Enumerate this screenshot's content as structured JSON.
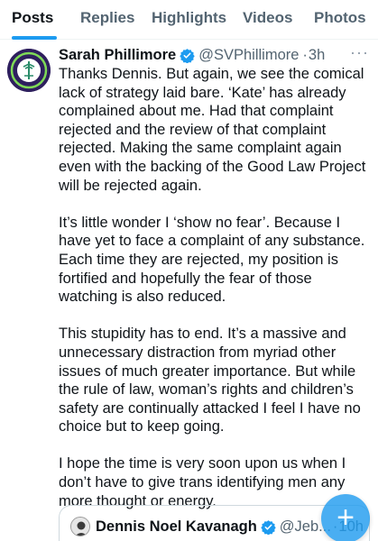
{
  "tabs": [
    {
      "label": "Posts",
      "active": true
    },
    {
      "label": "Replies",
      "active": false
    },
    {
      "label": "Highlights",
      "active": false
    },
    {
      "label": "Videos",
      "active": false
    },
    {
      "label": "Photos",
      "active": false
    }
  ],
  "post": {
    "author_name": "Sarah Phillimore",
    "handle": "@SVPhillimore",
    "separator": "·",
    "time": "3h",
    "more_label": "···",
    "paragraphs": [
      "Thanks Dennis. But again, we see the comical\nlack of strategy laid bare. ‘Kate’ has already\ncomplained about me. Had that complaint\nrejected and the review of that complaint\nrejected. Making the same complaint again\neven with the backing of the Good Law Project\nwill be rejected again.",
      "It’s little wonder I ‘show no fear’. Because I\nhave yet to face a complaint of any substance.\nEach time they are rejected, my position is\nfortified and hopefully the fear of those\nwatching is also reduced.",
      "This stupidity has to end. It’s a massive and\nunnecessary distraction from myriad other\nissues of much greater importance. But while\nthe rule of law, woman’s rights and children’s\nsafety are continually attacked I feel I have no\nchoice but to keep going.",
      "I hope the time is very soon upon us when I\ndon’t have to give trans identifying men any\nmore thought or energy."
    ]
  },
  "quoted": {
    "author_name": "Dennis Noel Kavanagh",
    "handle": "@Jeb...",
    "separator": "·",
    "time": "10h"
  },
  "fab_label": "+",
  "colors": {
    "accent": "#1d9bf0",
    "text": "#0f1419",
    "muted": "#536471",
    "avatar_bg": "#2e1f5e",
    "avatar_ring": "#7ed957"
  },
  "icons": {
    "verified": "verified-badge-icon",
    "compose": "plus-icon"
  }
}
